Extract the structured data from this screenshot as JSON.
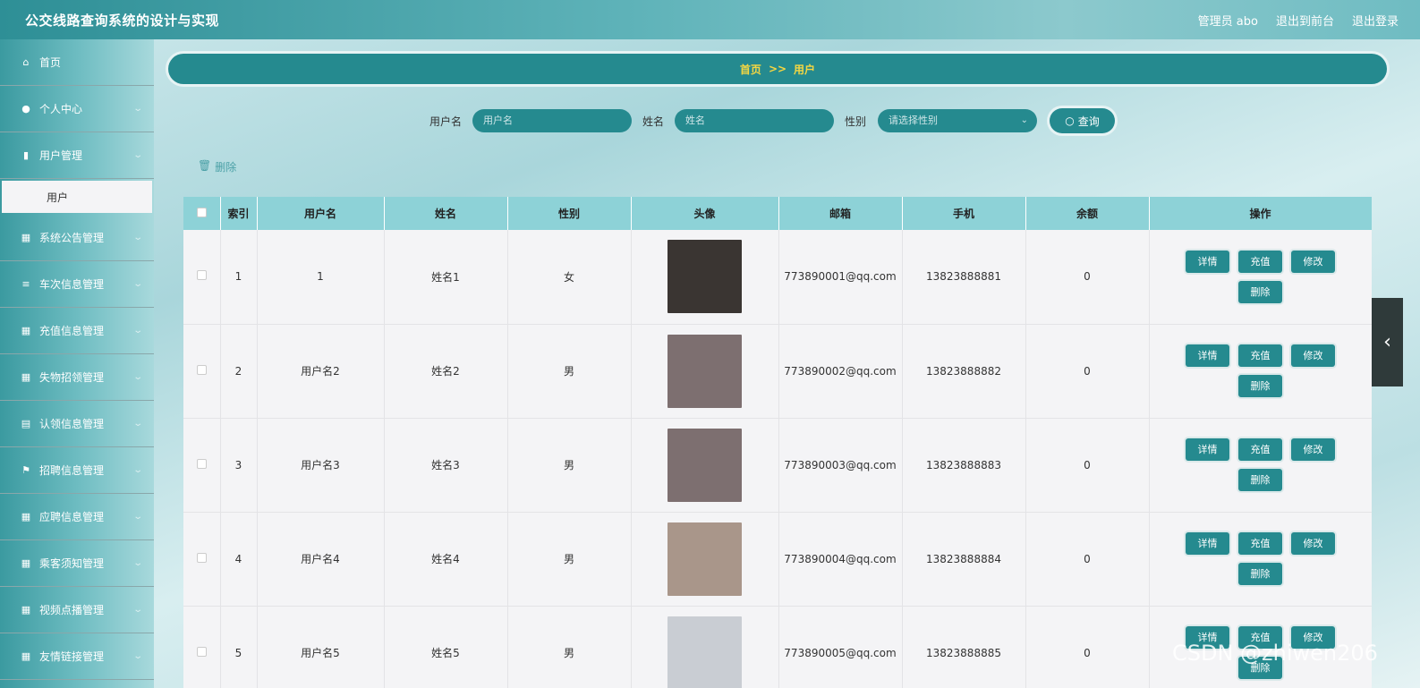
{
  "header": {
    "title": "公交线路查询系统的设计与实现",
    "links": [
      "管理员 abo",
      "退出到前台",
      "退出登录"
    ]
  },
  "sidebar": {
    "items": [
      {
        "label": "首页",
        "icon": "home-icon",
        "glyph": "⌂",
        "has_arrow": false
      },
      {
        "label": "个人中心",
        "icon": "user-icon",
        "glyph": "●",
        "has_arrow": true
      },
      {
        "label": "用户管理",
        "icon": "bar-chart-icon",
        "glyph": "▮",
        "has_arrow": true
      },
      {
        "label": "系统公告管理",
        "icon": "grid-icon",
        "glyph": "▦",
        "has_arrow": true
      },
      {
        "label": "车次信息管理",
        "icon": "list-icon",
        "glyph": "≡",
        "has_arrow": true
      },
      {
        "label": "充值信息管理",
        "icon": "table-icon",
        "glyph": "▦",
        "has_arrow": true
      },
      {
        "label": "失物招领管理",
        "icon": "table-icon",
        "glyph": "▦",
        "has_arrow": true
      },
      {
        "label": "认领信息管理",
        "icon": "document-icon",
        "glyph": "▤",
        "has_arrow": true
      },
      {
        "label": "招聘信息管理",
        "icon": "flag-icon",
        "glyph": "⚑",
        "has_arrow": true
      },
      {
        "label": "应聘信息管理",
        "icon": "grid-icon",
        "glyph": "▦",
        "has_arrow": true
      },
      {
        "label": "乘客须知管理",
        "icon": "grid-icon",
        "glyph": "▦",
        "has_arrow": true
      },
      {
        "label": "视频点播管理",
        "icon": "grid-icon",
        "glyph": "▦",
        "has_arrow": true
      },
      {
        "label": "友情链接管理",
        "icon": "grid-icon",
        "glyph": "▦",
        "has_arrow": true
      }
    ],
    "active_sub": "用户"
  },
  "breadcrumb": {
    "home": "首页",
    "sep": ">>",
    "current": "用户"
  },
  "search": {
    "username_label": "用户名",
    "username_placeholder": "用户名",
    "name_label": "姓名",
    "name_placeholder": "姓名",
    "gender_label": "性别",
    "gender_placeholder": "请选择性别",
    "query_label": "查询"
  },
  "toolbar": {
    "delete_label": "删除"
  },
  "table": {
    "columns": [
      "索引",
      "用户名",
      "姓名",
      "性别",
      "头像",
      "邮箱",
      "手机",
      "余额",
      "操作"
    ],
    "actions": [
      "详情",
      "充值",
      "修改",
      "删除"
    ],
    "rows": [
      {
        "index": "1",
        "username": "1",
        "name": "姓名1",
        "gender": "女",
        "email": "773890001@qq.com",
        "phone": "13823888881",
        "balance": "0",
        "avatar_color": "#3a3532"
      },
      {
        "index": "2",
        "username": "用户名2",
        "name": "姓名2",
        "gender": "男",
        "email": "773890002@qq.com",
        "phone": "13823888882",
        "balance": "0",
        "avatar_color": "#7d6f70"
      },
      {
        "index": "3",
        "username": "用户名3",
        "name": "姓名3",
        "gender": "男",
        "email": "773890003@qq.com",
        "phone": "13823888883",
        "balance": "0",
        "avatar_color": "#7d6f70"
      },
      {
        "index": "4",
        "username": "用户名4",
        "name": "姓名4",
        "gender": "男",
        "email": "773890004@qq.com",
        "phone": "13823888884",
        "balance": "0",
        "avatar_color": "#a9968a"
      },
      {
        "index": "5",
        "username": "用户名5",
        "name": "姓名5",
        "gender": "男",
        "email": "773890005@qq.com",
        "phone": "13823888885",
        "balance": "0",
        "avatar_color": "#c9cdd3"
      }
    ]
  },
  "watermark": "CSDN @zhiwen206"
}
